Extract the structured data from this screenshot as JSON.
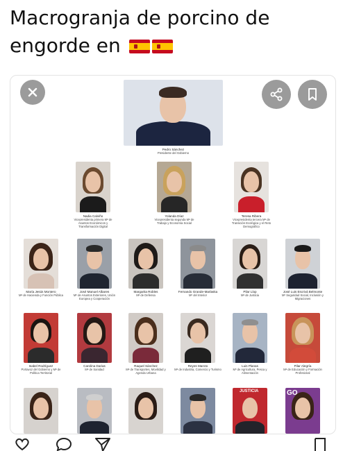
{
  "post": {
    "title_line1": "Macrogranja de porcino de",
    "title_line2": "engorde en",
    "flag_icons": [
      "spain-flag-icon",
      "spain-flag-icon"
    ]
  },
  "image_overlay": {
    "close_icon": "close-icon",
    "share_icon": "share-icon",
    "bookmark_icon": "bookmark-icon"
  },
  "people": [
    {
      "name": "Pedro Sánchez",
      "role": "Presidente del Gobierno"
    },
    {
      "name": "Nadia Calviño",
      "role": "Vicepresidenta primera Mª de Asuntos Económicos y Transformación Digital"
    },
    {
      "name": "Yolanda Díaz",
      "role": "Vicepresidenta segunda Mª de Trabajo y Economía Social"
    },
    {
      "name": "Teresa Ribera",
      "role": "Vicepresidenta tercera Mª de Transición Ecológica y el Reto Demográfico"
    },
    {
      "name": "María Jesús Montero",
      "role": "Mª de Hacienda y Función Pública"
    },
    {
      "name": "José Manuel Albares",
      "role": "Mº de Asuntos Exteriores, Unión Europea y Cooperación"
    },
    {
      "name": "Margarita Robles",
      "role": "Mª de Defensa"
    },
    {
      "name": "Fernando Grande-Marlaska",
      "role": "Mº del Interior"
    },
    {
      "name": "Pilar Llop",
      "role": "Mª de Justicia"
    },
    {
      "name": "José Luis Escrivá Belmonte",
      "role": "Mº Seguridad Social, Inclusión y Migraciones"
    },
    {
      "name": "Isabel Rodríguez",
      "role": "Portavoz del Gobierno y Mª de Política Territorial"
    },
    {
      "name": "Carolina Darias",
      "role": "Mª de Sanidad"
    },
    {
      "name": "Raquel Sánchez",
      "role": "Mª de Transportes, Movilidad y Agenda Urbana"
    },
    {
      "name": "Reyes Maroto",
      "role": "Mª de Industria, Comercio y Turismo"
    },
    {
      "name": "Luis Planas",
      "role": "Mº de Agricultura, Pesca y Alimentación"
    },
    {
      "name": "Pilar Alegría",
      "role": "Mª de Educación y Formación Profesional"
    },
    {
      "name": "",
      "role": ""
    },
    {
      "name": "",
      "role": ""
    },
    {
      "name": "",
      "role": ""
    },
    {
      "name": "",
      "role": ""
    },
    {
      "name": "",
      "role": ""
    },
    {
      "name": "",
      "role": ""
    }
  ],
  "bottom_text": {
    "justicia": "JUSTICIA",
    "go": "GO"
  },
  "actions": {
    "like_icon": "heart-icon",
    "reply_icon": "comment-icon",
    "share_icon": "send-icon",
    "save_icon": "bookmark-icon"
  },
  "colors": {
    "overlay_button": "#9b9b9b",
    "flag_red": "#c60b1e",
    "flag_yellow": "#ffc400"
  }
}
